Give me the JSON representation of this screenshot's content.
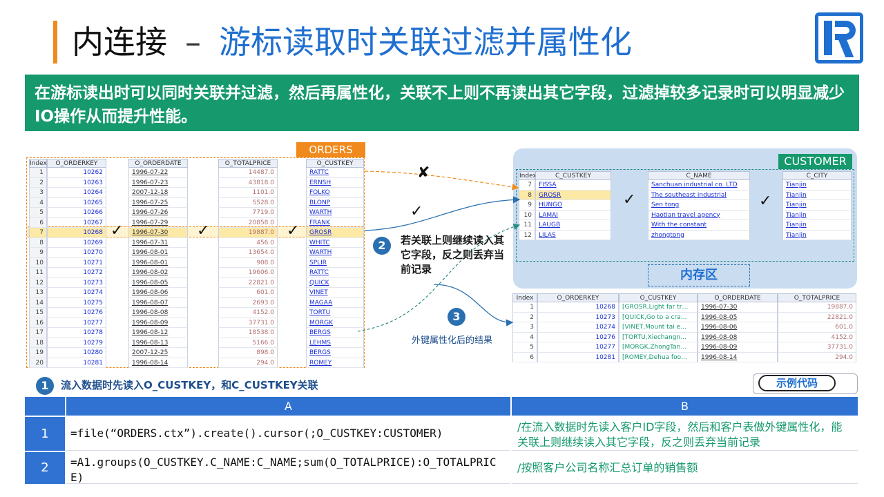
{
  "title": {
    "main": "内连接",
    "dash": "–",
    "sub": "游标读取时关联过滤并属性化"
  },
  "banner": "在游标读出时可以同时关联并过滤，然后再属性化，关联不上则不再读出其它字段，过滤掉较多记录时可以明显减少IO操作从而提升性能。",
  "orders": {
    "label": "ORDERS",
    "columns": [
      "Index",
      "O_ORDERKEY",
      "O_ORDERDATE",
      "O_TOTALPRICE",
      "O_CUSTKEY"
    ],
    "index": [
      "1",
      "2",
      "3",
      "4",
      "5",
      "6",
      "7",
      "8",
      "9",
      "10",
      "11",
      "12",
      "13",
      "14",
      "15",
      "16",
      "17",
      "18",
      "19",
      "20"
    ],
    "orderkey": [
      "10262",
      "10263",
      "10264",
      "10265",
      "10266",
      "10267",
      "10268",
      "10269",
      "10270",
      "10271",
      "10272",
      "10273",
      "10274",
      "10275",
      "10276",
      "10277",
      "10278",
      "10279",
      "10280",
      "10281"
    ],
    "orderdate": [
      "1996-07-22",
      "1996-07-23",
      "2007-12-18",
      "1996-07-25",
      "1996-07-26",
      "1996-07-29",
      "1996-07-30",
      "1996-07-31",
      "1996-08-01",
      "1996-08-01",
      "1996-08-02",
      "1996-08-05",
      "1996-08-06",
      "1996-08-07",
      "1996-08-08",
      "1996-08-09",
      "1996-08-12",
      "1996-08-13",
      "2007-12-25",
      "1996-08-14"
    ],
    "totalprice": [
      "14487.0",
      "43818.0",
      "1101.0",
      "5528.0",
      "7719.0",
      "20858.0",
      "19887.0",
      "456.0",
      "13654.0",
      "908.0",
      "19606.0",
      "22821.0",
      "601.0",
      "2693.0",
      "4152.0",
      "37731.0",
      "18538.0",
      "5166.0",
      "898.0",
      "294.0"
    ],
    "custkey": [
      "RATTC",
      "ERNSH",
      "FOLKO",
      "BLONP",
      "WARTH",
      "FRANK",
      "GROSR",
      "WHITC",
      "WARTH",
      "SPLIR",
      "RATTC",
      "QUICK",
      "VINET",
      "MAGAA",
      "TORTU",
      "MORGK",
      "BERGS",
      "LEHMS",
      "BERGS",
      "ROMEY"
    ]
  },
  "customer": {
    "label": "CUSTOMER",
    "columns": [
      "Index",
      "C_CUSTKEY",
      "C_NAME",
      "C_CITY"
    ],
    "rows": [
      {
        "index": "7",
        "key": "FISSA",
        "name": "Sanchuan industrial co. LTD",
        "city": "Tianjin"
      },
      {
        "index": "8",
        "key": "GROSR",
        "name": "The southeast industrial",
        "city": "Tianjin"
      },
      {
        "index": "9",
        "key": "HUNGO",
        "name": "Sen tong",
        "city": "Tianjin"
      },
      {
        "index": "10",
        "key": "LAMAI",
        "name": "Haotian travel agency",
        "city": "Tianjin"
      },
      {
        "index": "11",
        "key": "LAUGB",
        "name": "With the constant",
        "city": "Tianjin"
      },
      {
        "index": "12",
        "key": "LILAS",
        "name": "zhongtong",
        "city": "Tianjin"
      }
    ],
    "memory_label": "内存区"
  },
  "result": {
    "columns": [
      "Index",
      "O_ORDERKEY",
      "O_CUSTKEY",
      "O_ORDERDATE",
      "O_TOTALPRICE"
    ],
    "rows": [
      {
        "index": "1",
        "key": "10268",
        "cust": "[GROSR,Light far tr…",
        "date": "1996-07-30",
        "price": "19887.0"
      },
      {
        "index": "2",
        "key": "10273",
        "cust": "[QUICK,Go to a cra…",
        "date": "1996-08-05",
        "price": "22821.0"
      },
      {
        "index": "3",
        "key": "10274",
        "cust": "[VINET,Mount tai e…",
        "date": "1996-08-06",
        "price": "601.0"
      },
      {
        "index": "4",
        "key": "10276",
        "cust": "[TORTU,Xiechangn…",
        "date": "1996-08-08",
        "price": "4152.0"
      },
      {
        "index": "5",
        "key": "10277",
        "cust": "[MORGK,ZhongTan…",
        "date": "1996-08-09",
        "price": "37731.0"
      },
      {
        "index": "6",
        "key": "10281",
        "cust": "[ROMEY,Dehua foo…",
        "date": "1996-08-14",
        "price": "294.0"
      }
    ]
  },
  "marks": {
    "check": "✓",
    "cross": "✘"
  },
  "steps": {
    "s1_num": "1",
    "s1_text": "流入数据时先读入O_CUSTKEY，和C_CUSTKEY关联",
    "s2_num": "2",
    "s2_text": "若关联上则继续读入其它字段，反之则丢弃当前记录",
    "s3_num": "3",
    "s3_text": "外键属性化后的结果"
  },
  "example_label": "示例代码",
  "grid": {
    "col_a": "A",
    "col_b": "B",
    "rows": [
      {
        "num": "1",
        "a": "=file(“ORDERS.ctx”).create().cursor(;O_CUSTKEY:CUSTOMER)",
        "b": "/在流入数据时先读入客户ID字段，然后和客户表做外键属性化，能关联上则继续读入其它字段，反之则丢弃当前记录"
      },
      {
        "num": "2",
        "a": "=A1.groups(O_CUSTKEY.C_NAME:C_NAME;sum(O_TOTALPRICE):O_TOTALPRICE)",
        "b": "/按照客户公司名称汇总订单的销售额"
      }
    ]
  },
  "colors": {
    "accent_orange": "#f08a1c",
    "accent_green": "#15996d",
    "accent_blue": "#1f6fd0",
    "grid_blue": "#2f72d2"
  }
}
